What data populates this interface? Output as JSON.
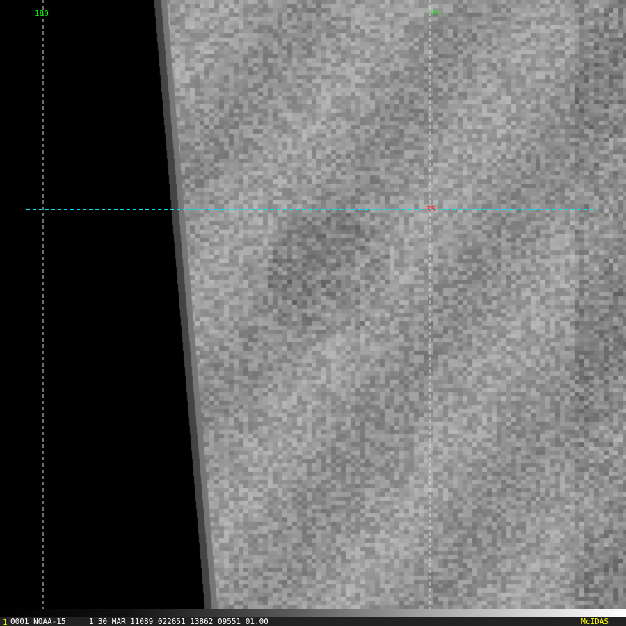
{
  "overlay": {
    "longitude_labels": [
      "180",
      "175"
    ],
    "latitude_label": "-35",
    "lon_label_color": "#00ff00",
    "lat_label_color": "#ff0000",
    "grid_color": "#00e5ff"
  },
  "status_bar": {
    "frame_number": "1",
    "text": "0001 NOAA-15     1 30 MAR 11089 022651 13862 09551 01.00",
    "brand": "McIDAS"
  }
}
